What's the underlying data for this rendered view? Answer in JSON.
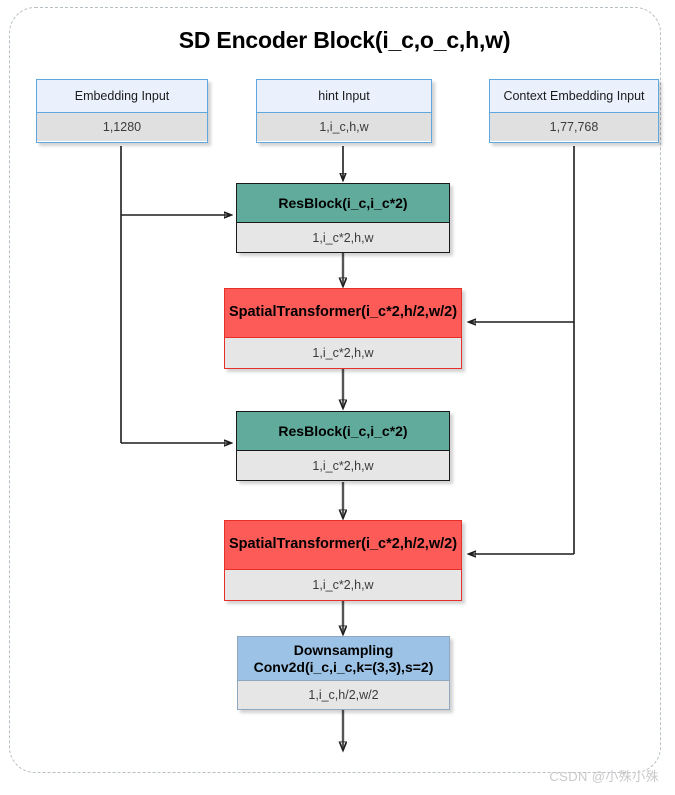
{
  "diagram": {
    "title": "SD Encoder Block(i_c,o_c,h,w)",
    "watermark": "CSDN @小殊小殊",
    "colors": {
      "input_header": "#eaf1fd",
      "input_border": "#5fa8dd",
      "resblock_header": "#61ab9c",
      "transformer_header": "#fc5b58",
      "transformer_border": "#e8302a",
      "downsample_header": "#9cc3e5",
      "shape_body": "#e6e6e6",
      "frame_dash": "#b9bfc6"
    }
  },
  "nodes": {
    "embedding_input": {
      "label": "Embedding Input",
      "shape": "1,1280"
    },
    "hint_input": {
      "label": "hint Input",
      "shape": "1,i_c,h,w"
    },
    "context_embedding_input": {
      "label": "Context Embedding Input",
      "shape": "1,77,768"
    },
    "resblock_1": {
      "label": "ResBlock(i_c,i_c*2)",
      "shape": "1,i_c*2,h,w"
    },
    "transformer_1": {
      "label": "SpatialTransformer(i_c*2,h/2,w/2)",
      "shape": "1,i_c*2,h,w"
    },
    "resblock_2": {
      "label": "ResBlock(i_c,i_c*2)",
      "shape": "1,i_c*2,h,w"
    },
    "transformer_2": {
      "label": "SpatialTransformer(i_c*2,h/2,w/2)",
      "shape": "1,i_c*2,h,w"
    },
    "downsampling": {
      "label_line1": "Downsampling",
      "label_line2": "Conv2d(i_c,i_c,k=(3,3),s=2)",
      "shape": "1,i_c,h/2,w/2"
    }
  }
}
